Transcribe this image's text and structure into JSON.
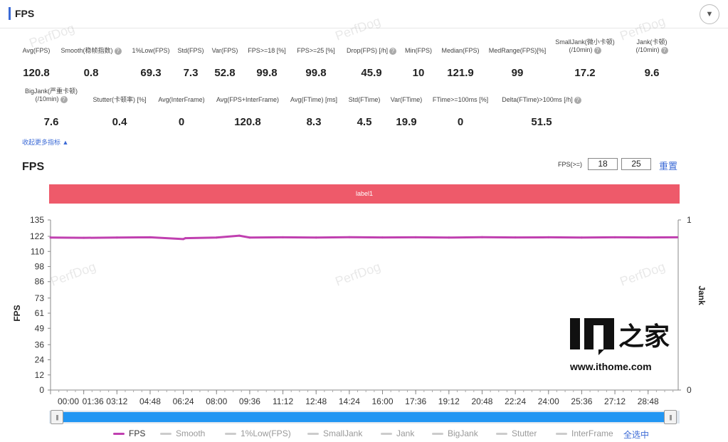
{
  "header": {
    "title": "FPS"
  },
  "watermark": "PerfDog",
  "metrics_row1": [
    {
      "label": "Avg(FPS)",
      "value": "120.8",
      "help": false
    },
    {
      "label": "Smooth(稳帧指数)",
      "value": "0.8",
      "help": true
    },
    {
      "label": "1%Low(FPS)",
      "value": "69.3",
      "help": false
    },
    {
      "label": "Std(FPS)",
      "value": "7.3",
      "help": false
    },
    {
      "label": "Var(FPS)",
      "value": "52.8",
      "help": false
    },
    {
      "label": "FPS>=18 [%]",
      "value": "99.8",
      "help": false
    },
    {
      "label": "FPS>=25 [%]",
      "value": "99.8",
      "help": false
    },
    {
      "label": "Drop(FPS) [/h]",
      "value": "45.9",
      "help": true
    },
    {
      "label": "Min(FPS)",
      "value": "10",
      "help": false
    },
    {
      "label": "Median(FPS)",
      "value": "121.9",
      "help": false
    },
    {
      "label": "MedRange(FPS)[%]",
      "value": "99",
      "help": false
    },
    {
      "label": "SmallJank(微小卡顿)",
      "label2": "(/10min)",
      "value": "17.2",
      "help": true
    },
    {
      "label": "Jank(卡顿)",
      "label2": "(/10min)",
      "value": "9.6",
      "help": true
    }
  ],
  "metrics_row2": [
    {
      "label": "BigJank(严重卡顿)",
      "label2": "(/10min)",
      "value": "7.6",
      "help": true
    },
    {
      "label": "Stutter(卡顿率) [%]",
      "value": "0.4",
      "help": false
    },
    {
      "label": "Avg(InterFrame)",
      "value": "0",
      "help": false
    },
    {
      "label": "Avg(FPS+InterFrame)",
      "value": "120.8",
      "help": false
    },
    {
      "label": "Avg(FTime) [ms]",
      "value": "8.3",
      "help": false
    },
    {
      "label": "Std(FTime)",
      "value": "4.5",
      "help": false
    },
    {
      "label": "Var(FTime)",
      "value": "19.9",
      "help": false
    },
    {
      "label": "FTime>=100ms [%]",
      "value": "0",
      "help": false
    },
    {
      "label": "Delta(FTime)>100ms [/h]",
      "value": "51.5",
      "help": true
    }
  ],
  "more_link": "收起更多指标 ▲",
  "chart_section": {
    "title": "FPS",
    "threshold_label": "FPS(>=)",
    "threshold_1": "18",
    "threshold_2": "25",
    "reset_label": "重置",
    "band_label": "label1"
  },
  "logo": {
    "text": "IT之家",
    "url_text": "www.ithome.com"
  },
  "legend": {
    "items": [
      {
        "name": "FPS",
        "color": "#c040b0",
        "active": true
      },
      {
        "name": "Smooth",
        "color": "#cccccc",
        "active": false
      },
      {
        "name": "1%Low(FPS)",
        "color": "#cccccc",
        "active": false
      },
      {
        "name": "SmallJank",
        "color": "#cccccc",
        "active": false
      },
      {
        "name": "Jank",
        "color": "#cccccc",
        "active": false
      },
      {
        "name": "BigJank",
        "color": "#cccccc",
        "active": false
      },
      {
        "name": "Stutter",
        "color": "#cccccc",
        "active": false
      },
      {
        "name": "InterFrame",
        "color": "#cccccc",
        "active": false
      }
    ],
    "select_all": "全选中"
  },
  "chart_data": {
    "type": "line",
    "ylabel": "FPS",
    "y2label": "Jank",
    "ylim": [
      0,
      135
    ],
    "yticks": [
      "135",
      "122",
      "110",
      "98",
      "86",
      "73",
      "61",
      "49",
      "36",
      "24",
      "12",
      "0"
    ],
    "y2ticks": [
      "1",
      "0"
    ],
    "xticks": [
      "00:00",
      "01:36",
      "03:12",
      "04:48",
      "06:24",
      "08:00",
      "09:36",
      "11:12",
      "12:48",
      "14:24",
      "16:00",
      "17:36",
      "19:12",
      "20:48",
      "22:24",
      "24:00",
      "25:36",
      "27:12",
      "28:48"
    ],
    "series": [
      {
        "name": "FPS",
        "color": "#c040b0",
        "x_minutes": [
          0,
          1.6,
          3.2,
          4.8,
          6.4,
          6.5,
          8.0,
          9.1,
          9.6,
          11.2,
          12.8,
          14.4,
          16.0,
          17.6,
          19.2,
          20.8,
          22.4,
          24.0,
          25.6,
          27.2,
          28.8,
          30.2
        ],
        "values": [
          121,
          120.8,
          121,
          121.2,
          119.8,
          120.5,
          121,
          122.5,
          121,
          121.2,
          121,
          121.3,
          121.1,
          121.2,
          121,
          121.3,
          121.1,
          121.2,
          121,
          121.2,
          121.1,
          121.2
        ]
      }
    ]
  }
}
